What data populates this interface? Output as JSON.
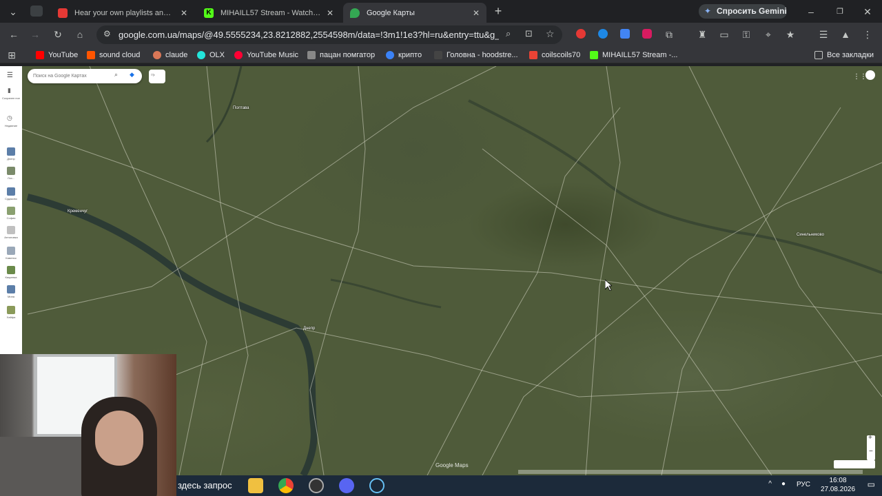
{
  "tabs": [
    {
      "title": "Hear your own playlists and the",
      "favicon_color": "#e53935"
    },
    {
      "title": "MIHAILL57 Stream - Watch Live",
      "favicon_color": "#53fc18"
    },
    {
      "title": "Google Карты",
      "favicon_color": "#34a853"
    }
  ],
  "gemini_label": "Спросить Gemini",
  "address": {
    "url": "google.com.ua/maps/@49.5555234,23.8212882,2554598m/data=!3m1!1e3?hl=ru&entry=ttu&g_e..."
  },
  "bookmarks": [
    {
      "label": "YouTube",
      "color": "#ff0000"
    },
    {
      "label": "sound cloud",
      "color": "#ff5500"
    },
    {
      "label": "claude",
      "color": "#d97757"
    },
    {
      "label": "OLX",
      "color": "#23e5db"
    },
    {
      "label": "YouTube Music",
      "color": "#ff0033"
    },
    {
      "label": "пацан помгатор",
      "color": "#888888"
    },
    {
      "label": "крипто",
      "color": "#3b82f6"
    },
    {
      "label": "Головна - hoodstre...",
      "color": "#444444"
    },
    {
      "label": "coilscoils70",
      "color": "#ea4335"
    },
    {
      "label": "MIHAILL57 Stream -...",
      "color": "#53fc18"
    }
  ],
  "all_bookmarks": "Все закладки",
  "map": {
    "search_placeholder": "Поиск на Google Картах",
    "watermark": "Google Maps",
    "cities": [
      "Полтава",
      "Кременчуг",
      "Днепр",
      "Синельниково"
    ]
  },
  "rail": [
    {
      "label": "Сохранен ное"
    },
    {
      "label": "Недавние"
    },
    {
      "label": "Днепр"
    },
    {
      "label": "Лоз..."
    },
    {
      "label": "Судаково"
    },
    {
      "label": "София"
    },
    {
      "label": "Антоновка"
    },
    {
      "label": "Каменск"
    },
    {
      "label": "Кицкевка"
    },
    {
      "label": "Мина"
    },
    {
      "label": "Хайфа"
    }
  ],
  "taskbar": {
    "search_text": "здесь запрос",
    "lang": "РУС",
    "time": "16:08",
    "date": "27.08.2026"
  }
}
